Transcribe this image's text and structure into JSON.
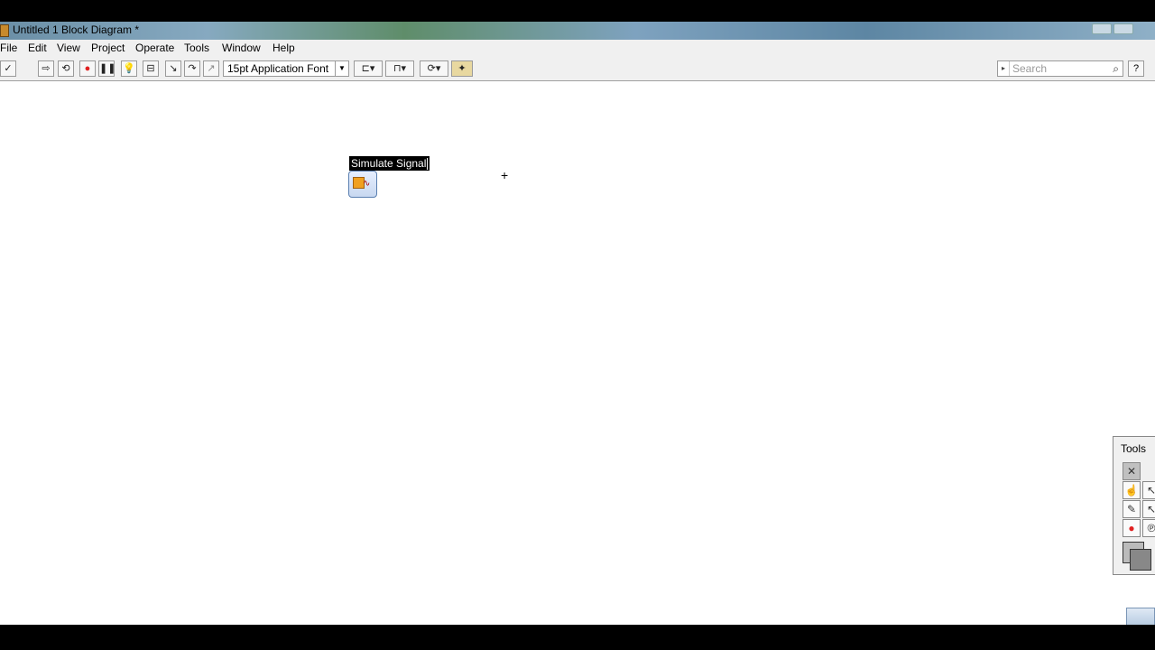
{
  "window": {
    "title": "Untitled 1 Block Diagram *"
  },
  "menu": {
    "items": [
      "File",
      "Edit",
      "View",
      "Project",
      "Operate",
      "Tools",
      "Window",
      "Help"
    ]
  },
  "toolbar": {
    "run_icon": "run-arrow-icon",
    "font": "15pt Application Font",
    "search_placeholder": "Search",
    "help_label": "?"
  },
  "diagram": {
    "node_label": "Simulate Signal",
    "node_icon": "simulate-signal-icon"
  },
  "tools_palette": {
    "title": "Tools"
  },
  "colors": {
    "selection_bg": "#000000",
    "canvas_bg": "#ffffff",
    "toolbar_bg": "#f0f0f0",
    "record_red": "#e02020"
  }
}
